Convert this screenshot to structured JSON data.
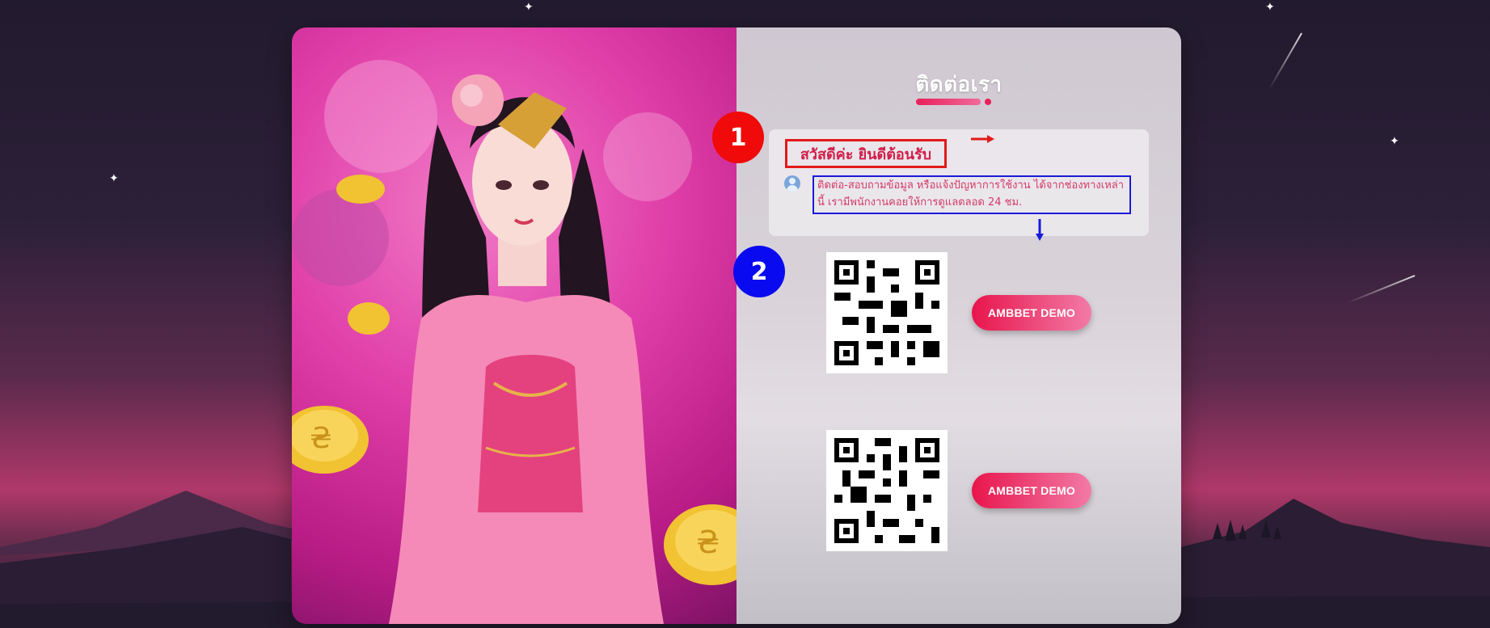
{
  "contact": {
    "title": "ติดต่อเรา",
    "greeting": "สวัสดีค่ะ ยินดีต้อนรับ",
    "description": "ติดต่อ-สอบถามข้อมูล หรือแจ้งปัญหาการใช้งาน ได้จากช่องทางเหล่านี้ เรามีพนักงานคอยให้การดูแลตลอด 24 ชม."
  },
  "annotations": {
    "marker_1": "1",
    "marker_2": "2"
  },
  "channels": [
    {
      "qr_label": "qr-code",
      "button_label": "AMBBET DEMO"
    },
    {
      "qr_label": "qr-code",
      "button_label": "AMBBET DEMO"
    }
  ],
  "colors": {
    "accent": "#e8154c",
    "annotation_red": "#f00a0a",
    "annotation_blue": "#0a0af0"
  }
}
